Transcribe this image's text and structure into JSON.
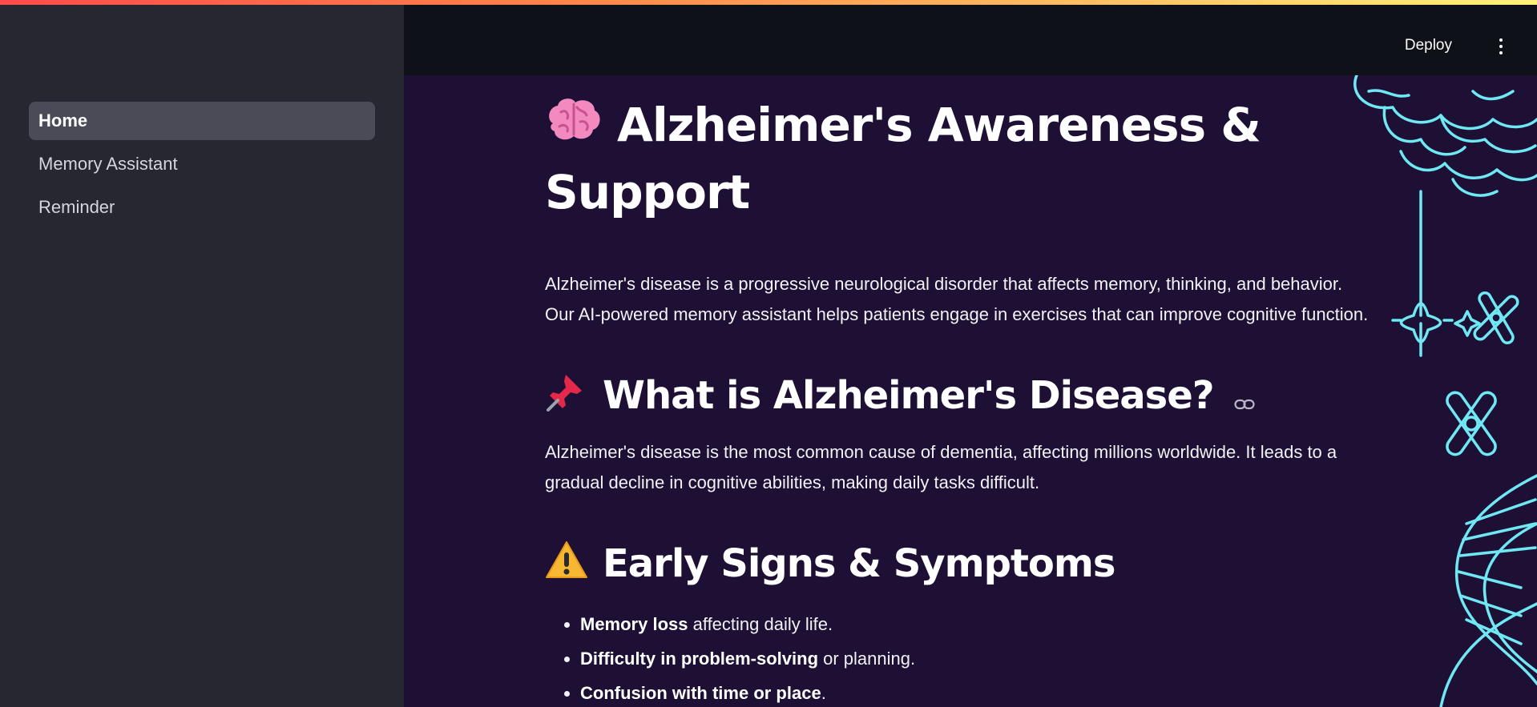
{
  "sidebar": {
    "items": [
      {
        "label": "Home",
        "active": true
      },
      {
        "label": "Memory Assistant",
        "active": false
      },
      {
        "label": "Reminder",
        "active": false
      }
    ]
  },
  "header": {
    "deploy_label": "Deploy",
    "menu_icon": "kebab-vertical-icon"
  },
  "main": {
    "title": "Alzheimer's Awareness & Support",
    "title_icon": "brain-emoji",
    "intro_line1": "Alzheimer's disease is a progressive neurological disorder that affects memory, thinking, and behavior.",
    "intro_line2": "Our AI-powered memory assistant helps patients engage in exercises that can improve cognitive function.",
    "section1": {
      "icon": "pushpin-emoji",
      "heading": "What is Alzheimer's Disease?",
      "text": "Alzheimer's disease is the most common cause of dementia, affecting millions worldwide. It leads to a gradual decline in cognitive abilities, making daily tasks difficult."
    },
    "section2": {
      "icon": "warning-emoji",
      "heading": "Early Signs & Symptoms",
      "items": [
        {
          "bold": "Memory loss",
          "rest": " affecting daily life."
        },
        {
          "bold": "Difficulty in problem-solving",
          "rest": " or planning."
        },
        {
          "bold": "Confusion with time or place",
          "rest": "."
        }
      ]
    }
  },
  "colors": {
    "sidebar_bg": "#262730",
    "header_bg": "#0e1118",
    "main_bg": "#1e1035",
    "decoration": "#6fe8f4",
    "accent_gradient": [
      "#ff4b4b",
      "#fff27a"
    ]
  }
}
